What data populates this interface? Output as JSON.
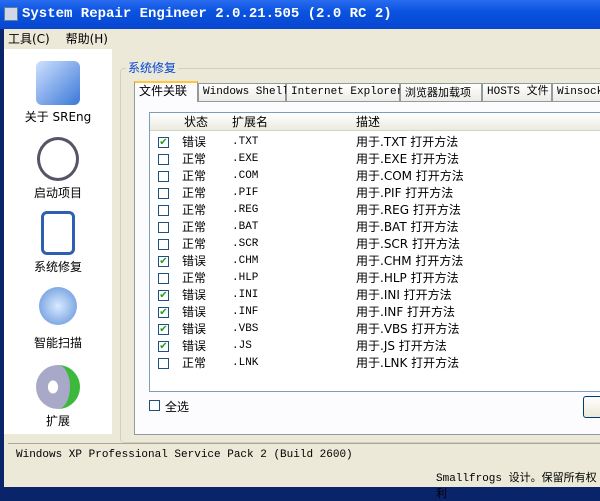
{
  "window": {
    "title": "System Repair Engineer 2.0.21.505 (2.0 RC 2)"
  },
  "menu": [
    "工具(C)",
    "帮助(H)"
  ],
  "sidebar": [
    {
      "label": "关于 SREng",
      "icon": "tools-icon"
    },
    {
      "label": "启动项目",
      "icon": "clock-icon"
    },
    {
      "label": "系统修复",
      "icon": "checklist-icon"
    },
    {
      "label": "智能扫描",
      "icon": "magnifier-icon"
    },
    {
      "label": "扩展",
      "icon": "gear-plus-icon"
    }
  ],
  "group": {
    "label": "系统修复"
  },
  "tabs": [
    "文件关联",
    "Windows Shell",
    "Internet Explorer",
    "浏览器加载项",
    "HOSTS 文件",
    "Winsock"
  ],
  "columns": [
    "状态",
    "扩展名",
    "描述"
  ],
  "rows": [
    {
      "checked": true,
      "status": "错误",
      "ext": ".TXT",
      "desc": "用于.TXT 打开方法"
    },
    {
      "checked": false,
      "status": "正常",
      "ext": ".EXE",
      "desc": "用于.EXE 打开方法"
    },
    {
      "checked": false,
      "status": "正常",
      "ext": ".COM",
      "desc": "用于.COM 打开方法"
    },
    {
      "checked": false,
      "status": "正常",
      "ext": ".PIF",
      "desc": "用于.PIF 打开方法"
    },
    {
      "checked": false,
      "status": "正常",
      "ext": ".REG",
      "desc": "用于.REG 打开方法"
    },
    {
      "checked": false,
      "status": "正常",
      "ext": ".BAT",
      "desc": "用于.BAT 打开方法"
    },
    {
      "checked": false,
      "status": "正常",
      "ext": ".SCR",
      "desc": "用于.SCR 打开方法"
    },
    {
      "checked": true,
      "status": "错误",
      "ext": ".CHM",
      "desc": "用于.CHM 打开方法"
    },
    {
      "checked": false,
      "status": "正常",
      "ext": ".HLP",
      "desc": "用于.HLP 打开方法"
    },
    {
      "checked": true,
      "status": "错误",
      "ext": ".INI",
      "desc": "用于.INI 打开方法"
    },
    {
      "checked": true,
      "status": "错误",
      "ext": ".INF",
      "desc": "用于.INF 打开方法"
    },
    {
      "checked": true,
      "status": "错误",
      "ext": ".VBS",
      "desc": "用于.VBS 打开方法"
    },
    {
      "checked": true,
      "status": "错误",
      "ext": ".JS",
      "desc": "用于.JS 打开方法"
    },
    {
      "checked": false,
      "status": "正常",
      "ext": ".LNK",
      "desc": "用于.LNK 打开方法"
    }
  ],
  "select_all": {
    "label": "全选",
    "checked": false
  },
  "status": {
    "os": "Windows XP Professional Service Pack 2 (Build 2600)",
    "copyright": "Smallfrogs 设计。保留所有权利"
  }
}
